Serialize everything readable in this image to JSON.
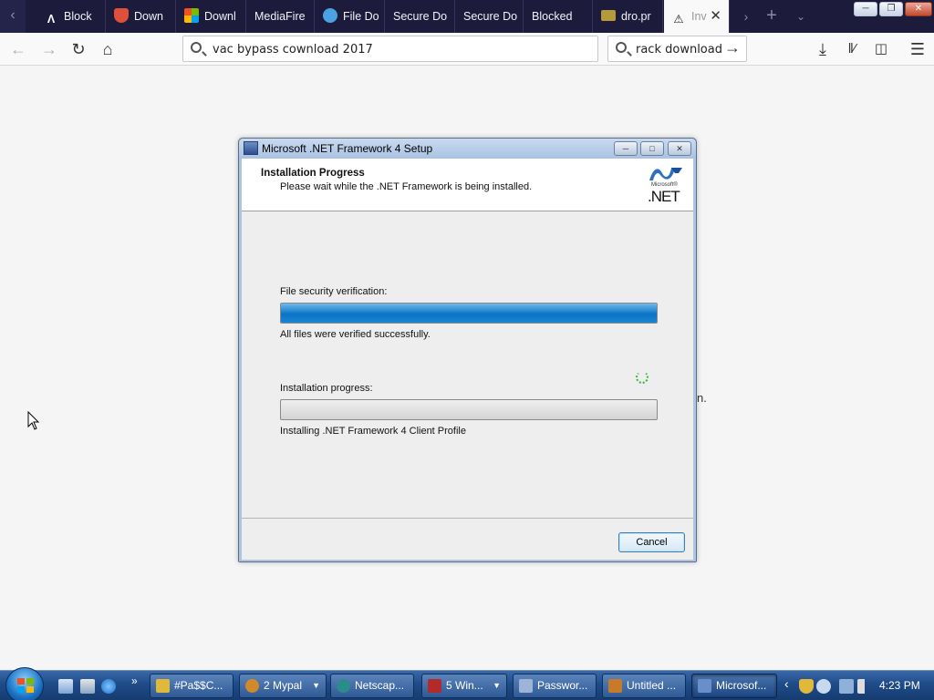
{
  "browser": {
    "tabs": [
      {
        "label": "Block",
        "icon": "a-logo-icon",
        "color": "#ffffff"
      },
      {
        "label": "Down",
        "icon": "shield-icon",
        "color": "#e04f39"
      },
      {
        "label": "Downl",
        "icon": "windows-icon",
        "color": "#f25022"
      },
      {
        "label": "MediaFire",
        "icon": "none",
        "color": "#ffffff"
      },
      {
        "label": "File Do",
        "icon": "cloud-icon",
        "color": "#4aa3e0"
      },
      {
        "label": "Secure Do",
        "icon": "none",
        "color": "#ffffff"
      },
      {
        "label": "Secure Do",
        "icon": "none",
        "color": "#ffffff"
      },
      {
        "label": "Blocked",
        "icon": "none",
        "color": "#ffffff"
      },
      {
        "label": "dro.pr",
        "icon": "folder-icon",
        "color": "#b59a3a"
      },
      {
        "label": "Inv",
        "icon": "warning-icon",
        "color": "#111111",
        "active": true
      }
    ],
    "url_value": "vac bypass cownload 2017",
    "search_value": "rack download"
  },
  "page": {
    "bg_fragment": "n."
  },
  "dialog": {
    "title": "Microsoft .NET Framework 4 Setup",
    "header_title": "Installation Progress",
    "header_subtitle": "Please wait while the .NET Framework is being installed.",
    "logo_small": "Microsoft®",
    "logo_big": ".NET",
    "verification_label": "File security verification:",
    "verification_progress": 1.0,
    "verification_status": "All files were verified successfully.",
    "install_label": "Installation progress:",
    "install_progress": 0.0,
    "install_status": "Installing .NET Framework 4 Client Profile",
    "cancel_label": "Cancel"
  },
  "taskbar": {
    "buttons": [
      {
        "label": "#Pa$$C...",
        "icon_color": "#e0b83a"
      },
      {
        "label": "2 Mypal",
        "icon_color": "#d08a2a",
        "count": "▼"
      },
      {
        "label": "Netscap...",
        "icon_color": "#2b8c8c"
      },
      {
        "label": "5 Win...",
        "icon_color": "#b22a2a",
        "count": "▼"
      },
      {
        "label": "Passwor...",
        "icon_color": "#9db4d8"
      },
      {
        "label": "Untitled ...",
        "icon_color": "#c77a2a"
      },
      {
        "label": "Microsof...",
        "icon_color": "#6a8fc8",
        "active": true
      }
    ],
    "clock": "4:23 PM"
  }
}
